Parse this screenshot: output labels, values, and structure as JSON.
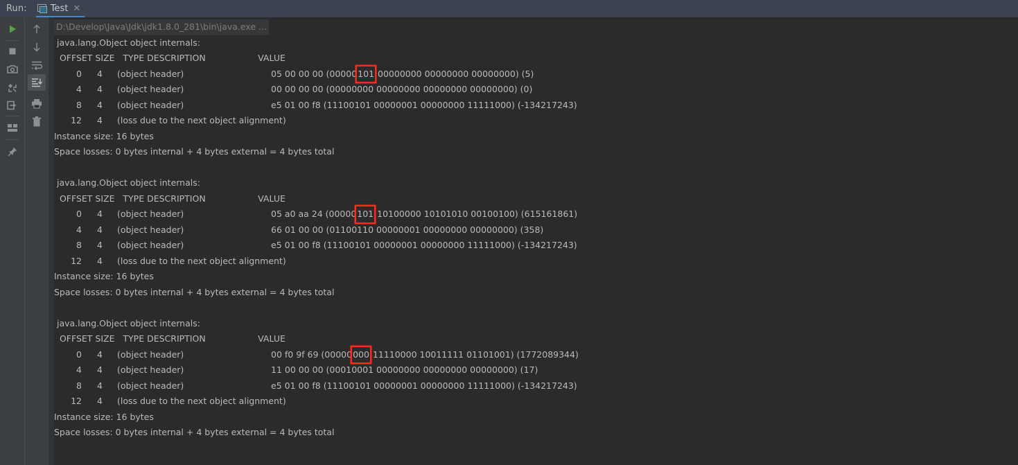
{
  "window": {
    "run_label": "Run:",
    "tab": {
      "title": "Test",
      "close_glyph": "✕",
      "icon": "run-configuration-icon"
    },
    "accent_color": "#4A88C7",
    "header_bg": "#3C4350",
    "console_bg": "#2B2B2B",
    "text_color": "#BBBBBB",
    "highlight_color": "#FF2A1C"
  },
  "toolbar_left": {
    "items": [
      {
        "name": "rerun-button",
        "glyph": "▶",
        "color": "#5A9E51"
      },
      {
        "name": "stop-button",
        "glyph": "■",
        "color": "#8E9194"
      },
      {
        "name": "screenshot-button",
        "glyph": "camera",
        "color": "#8E9194"
      },
      {
        "name": "dump-threads-button",
        "glyph": "threads",
        "color": "#8E9194"
      },
      {
        "name": "export-button",
        "glyph": "export",
        "color": "#8E9194"
      },
      {
        "name": "layout-settings-button",
        "glyph": "layout",
        "color": "#8E9194"
      },
      {
        "name": "pin-tab-button",
        "glyph": "pin",
        "color": "#8E9194"
      }
    ]
  },
  "toolbar_right": {
    "items": [
      {
        "name": "up-the-stack-trace-button",
        "glyph": "↑",
        "color": "#8E9194"
      },
      {
        "name": "down-the-stack-trace-button",
        "glyph": "↓",
        "color": "#8E9194"
      },
      {
        "name": "soft-wrap-button",
        "glyph": "wrap",
        "color": "#8E9194"
      },
      {
        "name": "scroll-to-end-button",
        "glyph": "scroll-end",
        "color": "#C0C3C6",
        "selected": true
      },
      {
        "name": "print-button",
        "glyph": "print",
        "color": "#8E9194"
      },
      {
        "name": "clear-all-button",
        "glyph": "trash",
        "color": "#8E9194"
      }
    ]
  },
  "console": {
    "command_line": "D:\\Develop\\Java\\Jdk\\jdk1.8.0_281\\bin\\java.exe ...",
    "header_title": "java.lang.Object object internals:",
    "columns": {
      "offset": "OFFSET",
      "size": "SIZE",
      "type_description": "TYPE DESCRIPTION",
      "value": "VALUE"
    },
    "blocks": [
      {
        "title": "java.lang.Object object internals:",
        "rows": [
          {
            "offset": "0",
            "size": "4",
            "description": "(object header)",
            "value_pre": "05 00 00 00 (00000",
            "value_highlight": "101",
            "value_post": " 00000000 00000000 00000000) (5)"
          },
          {
            "offset": "4",
            "size": "4",
            "description": "(object header)",
            "value_pre": "00 00 00 00 (00000000 00000000 00000000 00000000) (0)",
            "value_highlight": "",
            "value_post": ""
          },
          {
            "offset": "8",
            "size": "4",
            "description": "(object header)",
            "value_pre": "e5 01 00 f8 (11100101 00000001 00000000 11111000) (-134217243)",
            "value_highlight": "",
            "value_post": ""
          },
          {
            "offset": "12",
            "size": "4",
            "description": "(loss due to the next object alignment)",
            "value_pre": "",
            "value_highlight": "",
            "value_post": ""
          }
        ],
        "instance_size": "Instance size: 16 bytes",
        "space_losses": "Space losses: 0 bytes internal + 4 bytes external = 4 bytes total"
      },
      {
        "title": "java.lang.Object object internals:",
        "rows": [
          {
            "offset": "0",
            "size": "4",
            "description": "(object header)",
            "value_pre": "05 a0 aa 24 (00000",
            "value_highlight": "101",
            "value_post": " 10100000 10101010 00100100) (615161861)"
          },
          {
            "offset": "4",
            "size": "4",
            "description": "(object header)",
            "value_pre": "66 01 00 00 (01100110 00000001 00000000 00000000) (358)",
            "value_highlight": "",
            "value_post": ""
          },
          {
            "offset": "8",
            "size": "4",
            "description": "(object header)",
            "value_pre": "e5 01 00 f8 (11100101 00000001 00000000 11111000) (-134217243)",
            "value_highlight": "",
            "value_post": ""
          },
          {
            "offset": "12",
            "size": "4",
            "description": "(loss due to the next object alignment)",
            "value_pre": "",
            "value_highlight": "",
            "value_post": ""
          }
        ],
        "instance_size": "Instance size: 16 bytes",
        "space_losses": "Space losses: 0 bytes internal + 4 bytes external = 4 bytes total"
      },
      {
        "title": "java.lang.Object object internals:",
        "rows": [
          {
            "offset": "0",
            "size": "4",
            "description": "(object header)",
            "value_pre": "00 f0 9f 69 (00000",
            "value_highlight": "000",
            "value_post": " 11110000 10011111 01101001) (1772089344)"
          },
          {
            "offset": "4",
            "size": "4",
            "description": "(object header)",
            "value_pre": "11 00 00 00 (00010001 00000000 00000000 00000000) (17)",
            "value_highlight": "",
            "value_post": ""
          },
          {
            "offset": "8",
            "size": "4",
            "description": "(object header)",
            "value_pre": "e5 01 00 f8 (11100101 00000001 00000000 11111000) (-134217243)",
            "value_highlight": "",
            "value_post": ""
          },
          {
            "offset": "12",
            "size": "4",
            "description": "(loss due to the next object alignment)",
            "value_pre": "",
            "value_highlight": "",
            "value_post": ""
          }
        ],
        "instance_size": "Instance size: 16 bytes",
        "space_losses": "Space losses: 0 bytes internal + 4 bytes external = 4 bytes total"
      }
    ]
  }
}
